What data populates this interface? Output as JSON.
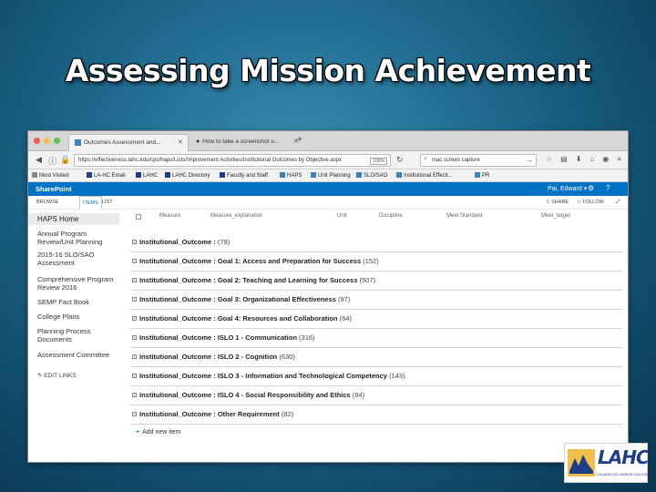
{
  "slide": {
    "title": "Assessing Mission Achievement"
  },
  "browser": {
    "tabs": [
      {
        "label": "Outcomes Assessment and...",
        "active": true
      },
      {
        "label": "How to take a screenshot o...",
        "active": false
      }
    ],
    "url": "https://effectiveness.lahc.edu/cpo/haps/Lists/Improvement Activities/Institutional Outcomes by Objective.aspx",
    "url_badge": "100%",
    "search_value": "mac screen capture",
    "bookmarks": [
      "Most Visited",
      "LA-HC Email",
      "LAHC",
      "LAHC Directory",
      "Faculty and Staff",
      "HAPS",
      "Unit Planning",
      "SLO/SAO",
      "Institutional Effecti...",
      "PR"
    ]
  },
  "sharepoint": {
    "brand": "SharePoint",
    "user": "Pai, Edward",
    "ribbon_tabs": [
      "BROWSE",
      "ITEMS",
      "LIST"
    ],
    "share": "SHARE",
    "follow": "FOLLOW"
  },
  "left_nav": {
    "home": "HAPS Home",
    "items": [
      "Annual Program Review/Unit Planning",
      "2015-16 SLO/SAO Assessment",
      "Comprehensive Program Review 2016",
      "SEMP Fact Book",
      "College Plans",
      "Planning Process Documents",
      "Assessment Committee"
    ],
    "edit_links": "EDIT LINKS"
  },
  "list": {
    "columns": [
      "Measure",
      "Measure_explanation",
      "Unit",
      "Discipline",
      "Meet Standard",
      "Meet_target"
    ],
    "groups": [
      {
        "name": "Institutional_Outcome :",
        "count": "(79)"
      },
      {
        "name": "Institutional_Outcome : Goal 1: Access and Preparation for Success",
        "count": "(152)"
      },
      {
        "name": "Institutional_Outcome : Goal 2: Teaching and Learning for Success",
        "count": "(507)"
      },
      {
        "name": "Institutional_Outcome : Goal 3: Organizational Effectiveness",
        "count": "(97)"
      },
      {
        "name": "Institutional_Outcome : Goal 4: Resources and Collaboration",
        "count": "(64)"
      },
      {
        "name": "Institutional_Outcome : ISLO 1 - Communication",
        "count": "(316)"
      },
      {
        "name": "Institutional_Outcome : ISLO 2 - Cognition",
        "count": "(630)"
      },
      {
        "name": "Institutional_Outcome : ISLO 3 - Information and Technological Competency",
        "count": "(143)"
      },
      {
        "name": "Institutional_Outcome : ISLO 4 - Social Responsibility and Ethics",
        "count": "(84)"
      },
      {
        "name": "Institutional_Outcome : Other Requirement",
        "count": "(82)"
      }
    ],
    "add_item": "Add new item"
  },
  "logo": {
    "letters": "LAHC",
    "subtitle": "LOS ANGELES HARBOR COLLEGE"
  }
}
